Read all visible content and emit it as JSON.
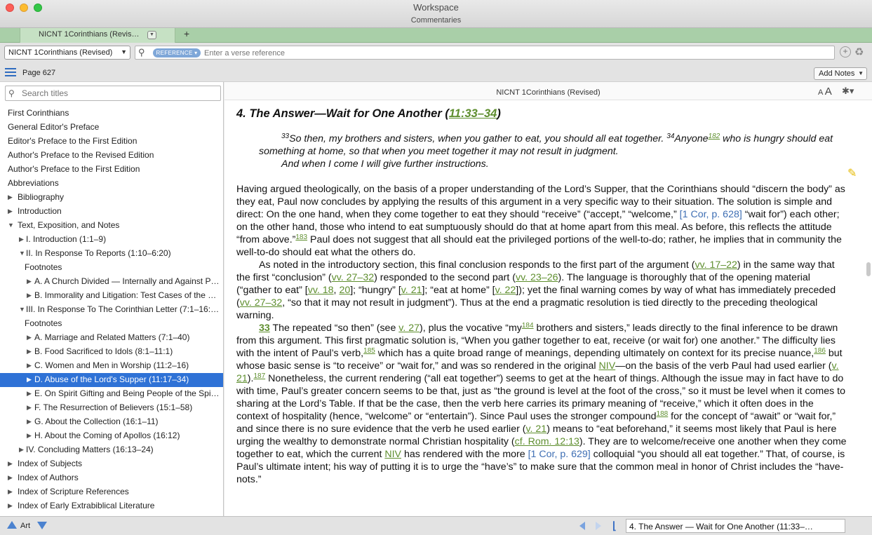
{
  "window": {
    "title": "Workspace",
    "subtitle": "Commentaries"
  },
  "tabs": [
    {
      "label": "NICNT 1Corinthians (Revis…"
    }
  ],
  "tab_add_label": "+",
  "toolbar": {
    "resource": "NICNT 1Corinthians (Revised)",
    "reference_chip": "REFERENCE",
    "reference_placeholder": "Enter a verse reference",
    "add_icon": "plus-circle-icon",
    "recycle_icon": "recycle-icon"
  },
  "page_row": {
    "page": "Page 627",
    "add_notes": "Add Notes"
  },
  "sidebar": {
    "search_placeholder": "Search titles",
    "items": [
      {
        "label": "First Corinthians",
        "level": 0,
        "toggle": "none"
      },
      {
        "label": "General Editor's Preface",
        "level": 0,
        "toggle": "none"
      },
      {
        "label": "Editor's Preface to the First Edition",
        "level": 0,
        "toggle": "none"
      },
      {
        "label": "Author's Preface to the Revised Edition",
        "level": 0,
        "toggle": "none"
      },
      {
        "label": "Author's Preface to the First Edition",
        "level": 0,
        "toggle": "none"
      },
      {
        "label": "Abbreviations",
        "level": 0,
        "toggle": "none"
      },
      {
        "label": "Bibliography",
        "level": 0,
        "toggle": "collapsed"
      },
      {
        "label": "Introduction",
        "level": 0,
        "toggle": "collapsed"
      },
      {
        "label": "Text, Exposition, and Notes",
        "level": 0,
        "toggle": "expanded"
      },
      {
        "label": "I. Introduction (1:1–9)",
        "level": 1,
        "toggle": "collapsed"
      },
      {
        "label": "II. In Response To Reports (1:10–6:20)",
        "level": 1,
        "toggle": "expanded"
      },
      {
        "label": "Footnotes",
        "level": 2,
        "toggle": "none"
      },
      {
        "label": "A. A Church Divided — Internally and Against P…",
        "level": 2,
        "toggle": "collapsed"
      },
      {
        "label": "B. Immorality and Litigation: Test Cases of the C…",
        "level": 2,
        "toggle": "collapsed"
      },
      {
        "label": "III. In Response To The Corinthian Letter (7:1–16:12)",
        "level": 1,
        "toggle": "expanded"
      },
      {
        "label": "Footnotes",
        "level": 2,
        "toggle": "none"
      },
      {
        "label": "A. Marriage and Related Matters (7:1–40)",
        "level": 2,
        "toggle": "collapsed"
      },
      {
        "label": "B. Food Sacrificed to Idols (8:1–11:1)",
        "level": 2,
        "toggle": "collapsed"
      },
      {
        "label": "C. Women and Men in Worship (11:2–16)",
        "level": 2,
        "toggle": "collapsed"
      },
      {
        "label": "D. Abuse of the Lord's Supper (11:17–34)",
        "level": 2,
        "toggle": "collapsed",
        "selected": true
      },
      {
        "label": "E. On Spirit Gifting and Being People of the Spir…",
        "level": 2,
        "toggle": "collapsed"
      },
      {
        "label": "F. The Resurrection of Believers (15:1–58)",
        "level": 2,
        "toggle": "collapsed"
      },
      {
        "label": "G. About the Collection (16:1–11)",
        "level": 2,
        "toggle": "collapsed"
      },
      {
        "label": "H. About the Coming of Apollos (16:12)",
        "level": 2,
        "toggle": "collapsed"
      },
      {
        "label": "IV. Concluding Matters (16:13–24)",
        "level": 1,
        "toggle": "collapsed"
      },
      {
        "label": "Index of Subjects",
        "level": 0,
        "toggle": "collapsed"
      },
      {
        "label": "Index of Authors",
        "level": 0,
        "toggle": "collapsed"
      },
      {
        "label": "Index of Scripture References",
        "level": 0,
        "toggle": "collapsed"
      },
      {
        "label": "Index of Early Extrabiblical Literature",
        "level": 0,
        "toggle": "collapsed"
      }
    ]
  },
  "reader": {
    "title": "NICNT 1Corinthians (Revised)",
    "font_small": "A",
    "font_large": "A",
    "heading_prefix": "4. The Answer—Wait for One Another (",
    "heading_ref": "11:33–34",
    "heading_suffix": ")",
    "quote": {
      "v33_num": "33",
      "v33_text": "So then, my brothers and sisters, when you gather to eat, you should all eat together. ",
      "v34_num": "34",
      "v34_text_a": "Anyone",
      "fn182": "182",
      "v34_text_b": " who is hungry should eat something at home, so that when you meet together it may not result in judgment.",
      "v34_line2": "And when I come I will give further instructions."
    },
    "p1": {
      "a": "Having argued theologically, on the basis of a proper understanding of the Lord’s Supper, that the Corinthians should “discern the body” as they eat, Paul now concludes by applying the results of this argument in a very specific way to their situation. The solution is simple and direct: On the one hand, when they come together to eat they should “receive” (“accept,” “welcome,” ",
      "link1": "[1 Cor, p. 628]",
      "b": " “wait for”) each other; on the other hand, those who intend to eat sumptuously should do that at home apart from this meal. As before, this reflects the attitude “from above.”",
      "fn183": "183",
      "c": " Paul does not suggest that all should eat the privileged portions of the well-to-do; rather, he implies that in community the well-to-do should eat what the others do."
    },
    "p2": {
      "a": "As noted in the introductory section, this final conclusion responds to the first part of the argument (",
      "r1": "vv. 17–22",
      "b": ") in the same way that the first “conclusion” (",
      "r2": "vv. 27–32",
      "c": ") responded to the second part (",
      "r3": "vv. 23–26",
      "d": "). The language is thoroughly that of the opening material (“gather to eat” [",
      "r4": "vv. 18",
      "r4b": "20",
      "e": "]; “hungry” [",
      "r5": "v. 21",
      "f": "]; “eat at home” [",
      "r6": "v. 22",
      "g": "]); yet the final warning comes by way of what has immediately preceded (",
      "r7": "vv. 27–32",
      "h": ", “so that it may not result in judgment”). Thus at the end a pragmatic resolution is tied directly to the preceding theological warning."
    },
    "p3": {
      "verse": "33",
      "a": " The repeated “so then” (see ",
      "r1": "v. 27",
      "b": "), plus the vocative “my",
      "fn184": "184",
      "c": " brothers and sisters,” leads directly to the final inference to be drawn from this argument. This first pragmatic solution is, “When you gather together to eat, receive (or wait for) one another.” The difficulty lies with the intent of Paul’s verb,",
      "fn185": "185",
      "d": " which has a quite broad range of meanings, depending ultimately on context for its precise nuance,",
      "fn186": "186",
      "e": " but whose basic sense is “to receive” or “wait for,” and was so rendered in the original ",
      "niv1": "NIV",
      "f": "—on the basis of the verb Paul had used earlier (",
      "r2": "v. 21",
      "g": ").",
      "fn187": "187",
      "h": " Nonetheless, the current rendering (“all eat together”) seems to get at the heart of things. Although the issue may in fact have to do with time, Paul’s greater concern seems to be that, just as “the ground is level at the foot of the cross,” so it must be level when it comes to sharing at the Lord’s Table. If that be the case, then the verb here carries its primary meaning of “receive,” which it often does in the context of hospitality (hence, “welcome” or “entertain”). Since Paul uses the stronger compound",
      "fn188": "188",
      "i": " for the concept of “await” or “wait for,” and since there is no sure evidence that the verb he used earlier (",
      "r3": "v. 21",
      "j": ") means to “eat beforehand,” it seems most likely that Paul is here urging the wealthy to demonstrate normal Christian hospitality (",
      "r4": "cf. Rom. 12:13",
      "k": "). They are to welcome/receive one another when they come together to eat, which the current ",
      "niv2": "NIV",
      "l": " has rendered with the more ",
      "link2": "[1 Cor, p. 629]",
      "m": " colloquial “you should all eat together.” That, of course, is Paul’s ultimate intent; his way of putting it is to urge the “have’s” to make sure that the common meal in honor of Christ includes the “have-nots.”"
    }
  },
  "status": {
    "art_label": "Art",
    "location": "4. The Answer — Wait for One Another (11:33–…"
  },
  "colors": {
    "tab_bar": "#a9cfa8",
    "selection": "#2f72d6",
    "link_green": "#5e8e2e",
    "link_blue": "#3f6fb4"
  }
}
